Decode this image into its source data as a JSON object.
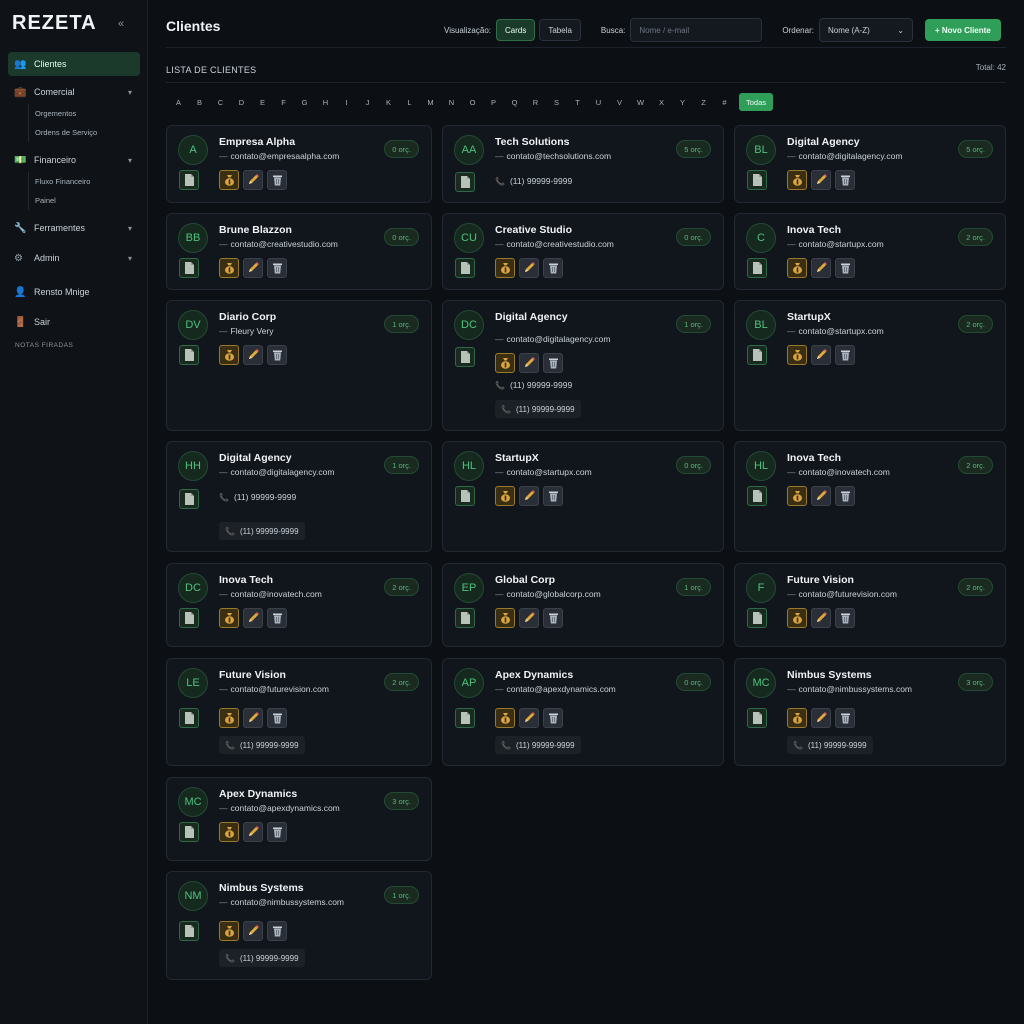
{
  "app": {
    "logo": "REZETA",
    "collapse": "«"
  },
  "sidebar": {
    "items": [
      {
        "label": "Clientes",
        "icon": "users-icon",
        "glyph": "👥"
      },
      {
        "label": "Comercial",
        "icon": "briefcase-icon",
        "glyph": "💼",
        "chev": "▾"
      },
      {
        "label": "Financeiro",
        "icon": "money-icon",
        "glyph": "💵",
        "chev": "▾"
      },
      {
        "label": "Ferramentes",
        "icon": "wrench-icon",
        "glyph": "🔧",
        "chev": "▾"
      },
      {
        "label": "Admin",
        "icon": "gear-icon",
        "glyph": "⚙",
        "chev": "▾"
      },
      {
        "label": "Rensto Mnige",
        "icon": "user-icon",
        "glyph": "👤"
      },
      {
        "label": "Sair",
        "icon": "door-icon",
        "glyph": "🚪"
      }
    ],
    "comercial_sub": [
      "Orgementos",
      "Ordens de Serviço"
    ],
    "financeiro_sub": [
      "Fluxo Financeiro",
      "Painel"
    ],
    "notes": "NOTAS FIRADAS"
  },
  "header": {
    "title": "Clientes",
    "view_label": "Visualização:",
    "view_cards": "Cards",
    "view_table": "Tabela",
    "search_label": "Busca:",
    "search_placeholder": "Nome / e-mail",
    "sort_label": "Ordenar:",
    "sort_value": "Nome (A-Z)",
    "sort_chev": "⌄",
    "new_button": "+ Novo Cliente"
  },
  "list": {
    "title": "LISTA DE CLIENTES",
    "total": "Total: 42",
    "letters": [
      "A",
      "B",
      "C",
      "D",
      "E",
      "F",
      "G",
      "H",
      "I",
      "J",
      "K",
      "L",
      "M",
      "N",
      "O",
      "P",
      "Q",
      "R",
      "S",
      "T",
      "U",
      "V",
      "W",
      "X",
      "Y",
      "Z",
      "#"
    ],
    "all_label": "Todas"
  },
  "colors": {
    "accent": "#2f9e59",
    "bg": "#0c0f14",
    "card": "#11161c",
    "gold": "#d9a441"
  },
  "cards": [
    {
      "initials": "A",
      "name": "Empresa Alpha",
      "email": "contato@empresaalpha.com",
      "badge": "0 orç."
    },
    {
      "initials": "AA",
      "name": "Tech Solutions",
      "email": "contato@techsolutions.com",
      "badge": "5 orç.",
      "phone": "(11) 99999-9999"
    },
    {
      "initials": "BL",
      "name": "Digital Agency",
      "email": "contato@digitalagency.com",
      "badge": "5 orç."
    },
    {
      "initials": "BB",
      "name": "Brune Blazzon",
      "email": "contato@creativestudio.com",
      "badge": "0 orç."
    },
    {
      "initials": "CU",
      "name": "Creative Studio",
      "email": "contato@creativestudio.com",
      "badge": "0 orç."
    },
    {
      "initials": "C",
      "name": "Inova Tech",
      "email": "contato@startupx.com",
      "badge": "2 orç."
    },
    {
      "initials": "DV",
      "name": "Diario Corp",
      "email": "Fleury Very",
      "badge": "1 orç."
    },
    {
      "initials": "DC",
      "name": "Digital Agency",
      "email": "contato@digitalagency.com",
      "badge": "1 orç.",
      "phone": "(11) 99999-9999",
      "chip": "(11) 99999-9999"
    },
    {
      "initials": "BL",
      "name": "StartupX",
      "email": "contato@startupx.com",
      "badge": "2 orç."
    },
    {
      "initials": "HH",
      "name": "Digital Agency",
      "email": "contato@digitalagency.com",
      "badge": "1 orç.",
      "phone": "(11) 99999-9999",
      "chip": "(11) 99999-9999"
    },
    {
      "initials": "HL",
      "name": "StartupX",
      "email": "contato@startupx.com",
      "badge": "0 orç."
    },
    {
      "initials": "HL",
      "name": "Inova Tech",
      "email": "contato@inovatech.com",
      "badge": "2 orç."
    },
    {
      "initials": "DC",
      "name": "Inova Tech",
      "email": "contato@inovatech.com",
      "badge": "2 orç."
    },
    {
      "initials": "EP",
      "name": "Global Corp",
      "email": "contato@globalcorp.com",
      "badge": "1 orç."
    },
    {
      "initials": "F",
      "name": "Future Vision",
      "email": "contato@futurevision.com",
      "badge": "2 orç."
    },
    {
      "initials": "LE",
      "name": "Future Vision",
      "email": "contato@futurevision.com",
      "badge": "2 orç.",
      "chip": "(11) 99999-9999"
    },
    {
      "initials": "AP",
      "name": "Apex Dynamics",
      "email": "contato@apexdynamics.com",
      "badge": "0 orç.",
      "chip": "(11) 99999-9999"
    },
    {
      "initials": "MC",
      "name": "Nimbus Systems",
      "email": "contato@nimbussystems.com",
      "badge": "3 orç.",
      "chip": "(11) 99999-9999"
    },
    {
      "initials": "MC",
      "name": "Apex Dynamics",
      "email": "contato@apexdynamics.com",
      "badge": "3 orç."
    },
    {
      "initials": "NM",
      "name": "Nimbus Systems",
      "email": "contato@nimbussystems.com",
      "badge": "1 orç.",
      "chip": "(11) 99999-9999"
    }
  ]
}
